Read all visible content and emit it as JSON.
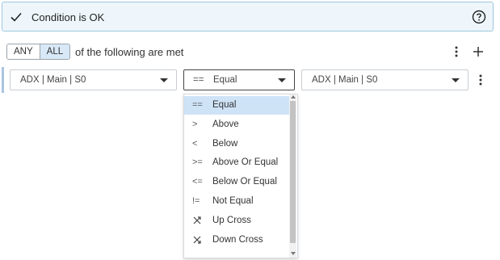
{
  "status": {
    "title": "Condition is OK",
    "check_icon": "check-icon",
    "help_icon": "help-circle-icon"
  },
  "toolbar": {
    "any_label": "ANY",
    "all_label": "ALL",
    "active": "ALL",
    "following_text": "of the following are met",
    "more_icon": "more-vertical-icon",
    "add_icon": "plus-icon"
  },
  "condition": {
    "left_value": "ADX | Main | S0",
    "operator_symbol": "==",
    "operator_label": "Equal",
    "right_value": "ADX | Main | S0",
    "more_icon": "more-vertical-icon"
  },
  "operator_options": [
    {
      "symbol": "==",
      "label": "Equal",
      "selected": true
    },
    {
      "symbol": ">",
      "label": "Above"
    },
    {
      "symbol": "<",
      "label": "Below"
    },
    {
      "symbol": ">=",
      "label": "Above Or Equal"
    },
    {
      "symbol": "<=",
      "label": "Below Or Equal"
    },
    {
      "symbol": "!=",
      "label": "Not Equal"
    },
    {
      "symbol": "cross-up-icon",
      "label": "Up Cross"
    },
    {
      "symbol": "cross-down-icon",
      "label": "Down Cross"
    }
  ],
  "colors": {
    "status_bg": "#eef6fb",
    "status_border": "#9ec6de",
    "active_toggle": "#d8e8f6",
    "selected_option": "#cfe3f7"
  }
}
